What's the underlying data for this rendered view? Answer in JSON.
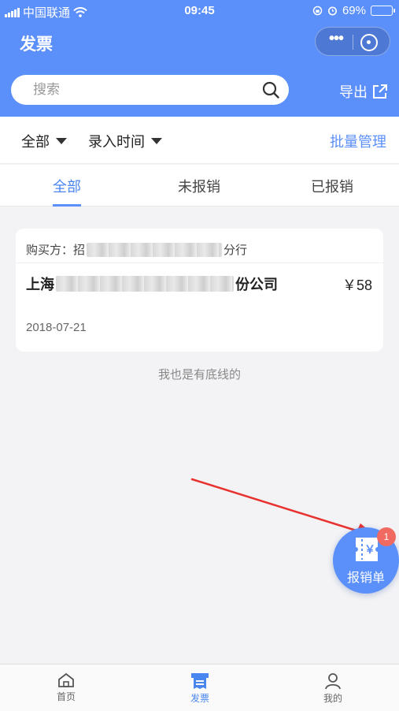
{
  "status_bar": {
    "carrier": "中国联通",
    "time": "09:45",
    "battery": "69%",
    "battery_level": 0.69
  },
  "header": {
    "title": "发票",
    "search_placeholder": "搜索",
    "export_label": "导出"
  },
  "filters": {
    "all_label": "全部",
    "time_label": "录入时间",
    "batch_label": "批量管理"
  },
  "tabs": [
    {
      "label": "全部",
      "active": true
    },
    {
      "label": "未报销",
      "active": false
    },
    {
      "label": "已报销",
      "active": false
    }
  ],
  "invoice": {
    "buyer_prefix": "购买方：招",
    "buyer_suffix": "分行",
    "seller_prefix": "上海",
    "seller_suffix": "份公司",
    "amount": "￥58",
    "date": "2018-07-21"
  },
  "list_end_text": "我也是有底线的",
  "fab": {
    "label": "报销单",
    "badge": "1",
    "icon_glyph": "￥"
  },
  "tabbar": [
    {
      "label": "首页",
      "icon": "home-icon",
      "active": false
    },
    {
      "label": "发票",
      "icon": "invoice-icon",
      "active": true
    },
    {
      "label": "我的",
      "icon": "user-icon",
      "active": false
    }
  ],
  "colors": {
    "primary": "#5b8ff9",
    "badge": "#f06a61",
    "arrow": "#e8322f"
  }
}
